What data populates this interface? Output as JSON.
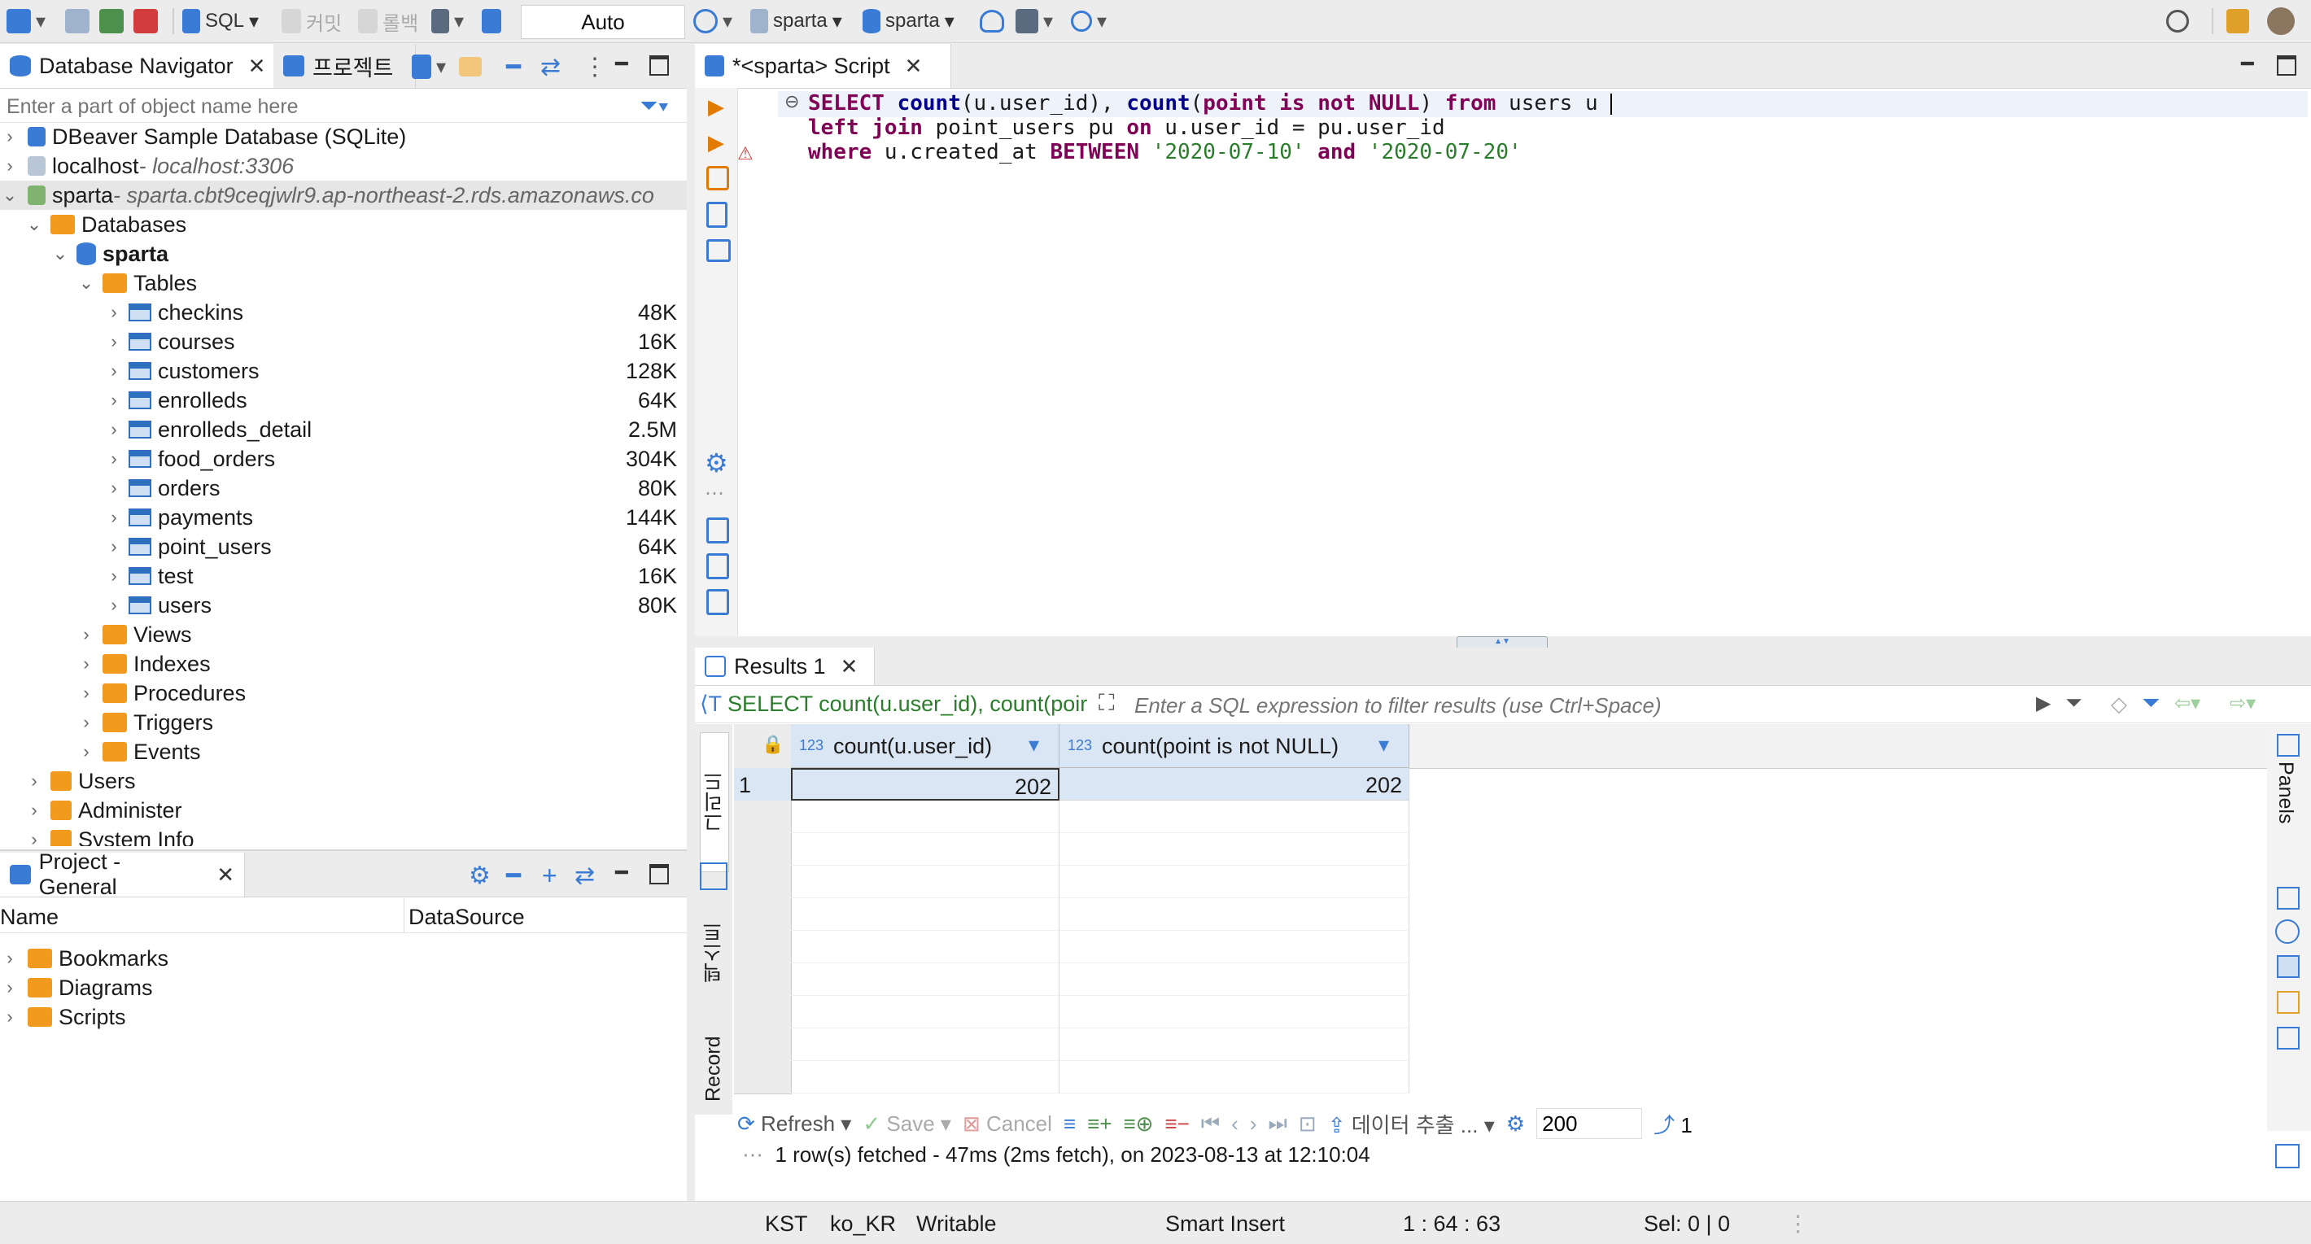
{
  "toolbar": {
    "sql_label": "SQL",
    "commit_label": "커밋",
    "rollback_label": "롤백",
    "transaction_mode": "Auto",
    "connection_label": "sparta",
    "schema_label": "sparta"
  },
  "navigator": {
    "tab_label": "Database Navigator",
    "projects_tab_label": "프로젝트",
    "filter_placeholder": "Enter a part of object name here",
    "connections": [
      {
        "name": "DBeaver Sample Database (SQLite)",
        "host": ""
      },
      {
        "name": "localhost",
        "host": " - localhost:3306"
      },
      {
        "name": "sparta",
        "host": " - sparta.cbt9ceqjwlr9.ap-northeast-2.rds.amazonaws.co"
      }
    ],
    "databases_label": "Databases",
    "schema_label": "sparta",
    "tables_label": "Tables",
    "tables": [
      {
        "name": "checkins",
        "size": "48K"
      },
      {
        "name": "courses",
        "size": "16K"
      },
      {
        "name": "customers",
        "size": "128K"
      },
      {
        "name": "enrolleds",
        "size": "64K"
      },
      {
        "name": "enrolleds_detail",
        "size": "2.5M"
      },
      {
        "name": "food_orders",
        "size": "304K"
      },
      {
        "name": "orders",
        "size": "80K"
      },
      {
        "name": "payments",
        "size": "144K"
      },
      {
        "name": "point_users",
        "size": "64K"
      },
      {
        "name": "test",
        "size": "16K"
      },
      {
        "name": "users",
        "size": "80K"
      }
    ],
    "folders": [
      "Views",
      "Indexes",
      "Procedures",
      "Triggers",
      "Events"
    ],
    "other_nodes": [
      "Users",
      "Administer",
      "System Info"
    ]
  },
  "project": {
    "tab_label": "Project - General",
    "col_name": "Name",
    "col_datasource": "DataSource",
    "items": [
      "Bookmarks",
      "Diagrams",
      "Scripts"
    ]
  },
  "editor": {
    "tab_label": "*<sparta> Script",
    "line1": {
      "select": "SELECT",
      "count1": "count",
      "p1": "(u.user_id), ",
      "count2": "count",
      "p2": "(",
      "point": "point",
      "is": "is",
      "not": "not",
      "null": "NULL",
      "p3": ") ",
      "from": "from",
      "rest": " users u"
    },
    "line2": {
      "left_join": "left join",
      "mid": " point_users pu ",
      "on": "on",
      "rest": " u.user_id = pu.user_id"
    },
    "line3": {
      "where": "where",
      "mid": " u.created_at ",
      "between": "BETWEEN",
      "d1": "'2020-07-10'",
      "and": "and",
      "d2": "'2020-07-20'"
    }
  },
  "results": {
    "tab_label": "Results 1",
    "query_preview": "SELECT count(u.user_id), count(poir",
    "filter_placeholder": "Enter a SQL expression to filter results (use Ctrl+Space)",
    "columns": [
      {
        "type": "123",
        "name": "count(u.user_id)"
      },
      {
        "type": "123",
        "name": "count(point is not NULL)"
      }
    ],
    "rows": [
      {
        "num": "1",
        "values": [
          "202",
          "202"
        ]
      }
    ],
    "side_tabs": {
      "grid": "그리드",
      "text": "텍스트",
      "record": "Record"
    },
    "panels_label": "Panels",
    "refresh_label": "Refresh",
    "save_label": "Save",
    "cancel_label": "Cancel",
    "export_label": "데이터 추출 ...",
    "fetch_size": "200",
    "row_count": "1",
    "status": "1 row(s) fetched - 47ms (2ms fetch), on 2023-08-13 at 12:10:04"
  },
  "statusbar": {
    "timezone": "KST",
    "locale": "ko_KR",
    "mode": "Writable",
    "insert_mode": "Smart Insert",
    "cursor": "1 : 64 : 63",
    "selection": "Sel: 0 | 0"
  },
  "colors": {
    "accent": "#2f6fbf",
    "folder": "#f29a1d",
    "header_bg": "#dbe6f4"
  }
}
